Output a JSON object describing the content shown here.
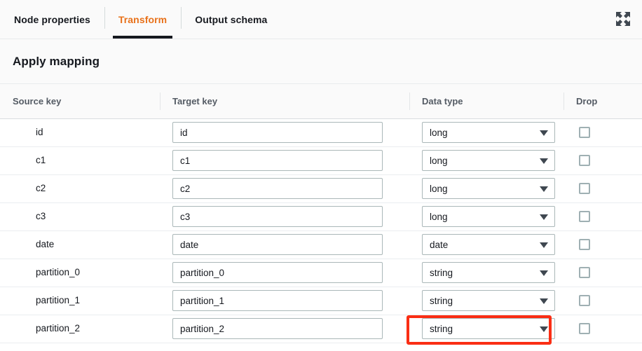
{
  "tabs": [
    {
      "label": "Node properties",
      "active": false
    },
    {
      "label": "Transform",
      "active": true
    },
    {
      "label": "Output schema",
      "active": false
    }
  ],
  "toolbar": {
    "expand_icon": "expand-arrows-icon"
  },
  "section": {
    "title": "Apply mapping"
  },
  "table": {
    "columns": [
      {
        "label": "Source key"
      },
      {
        "label": "Target key"
      },
      {
        "label": "Data type"
      },
      {
        "label": "Drop"
      }
    ],
    "rows": [
      {
        "source_key": "id",
        "target_key": "id",
        "data_type": "long",
        "drop": false,
        "highlighted": false
      },
      {
        "source_key": "c1",
        "target_key": "c1",
        "data_type": "long",
        "drop": false,
        "highlighted": false
      },
      {
        "source_key": "c2",
        "target_key": "c2",
        "data_type": "long",
        "drop": false,
        "highlighted": false
      },
      {
        "source_key": "c3",
        "target_key": "c3",
        "data_type": "long",
        "drop": false,
        "highlighted": false
      },
      {
        "source_key": "date",
        "target_key": "date",
        "data_type": "date",
        "drop": false,
        "highlighted": true
      },
      {
        "source_key": "partition_0",
        "target_key": "partition_0",
        "data_type": "string",
        "drop": false,
        "highlighted": false
      },
      {
        "source_key": "partition_1",
        "target_key": "partition_1",
        "data_type": "string",
        "drop": false,
        "highlighted": false
      },
      {
        "source_key": "partition_2",
        "target_key": "partition_2",
        "data_type": "string",
        "drop": false,
        "highlighted": false
      }
    ]
  },
  "annotation": {
    "color": "#fa2e14",
    "target": "data-type-select-date"
  },
  "colors": {
    "active_tab_text": "#e8711a",
    "active_tab_underline": "#16191f",
    "header_bg": "#fafafa",
    "text": "#16191f",
    "muted_text": "#545b64",
    "border": "#aab7b8"
  }
}
